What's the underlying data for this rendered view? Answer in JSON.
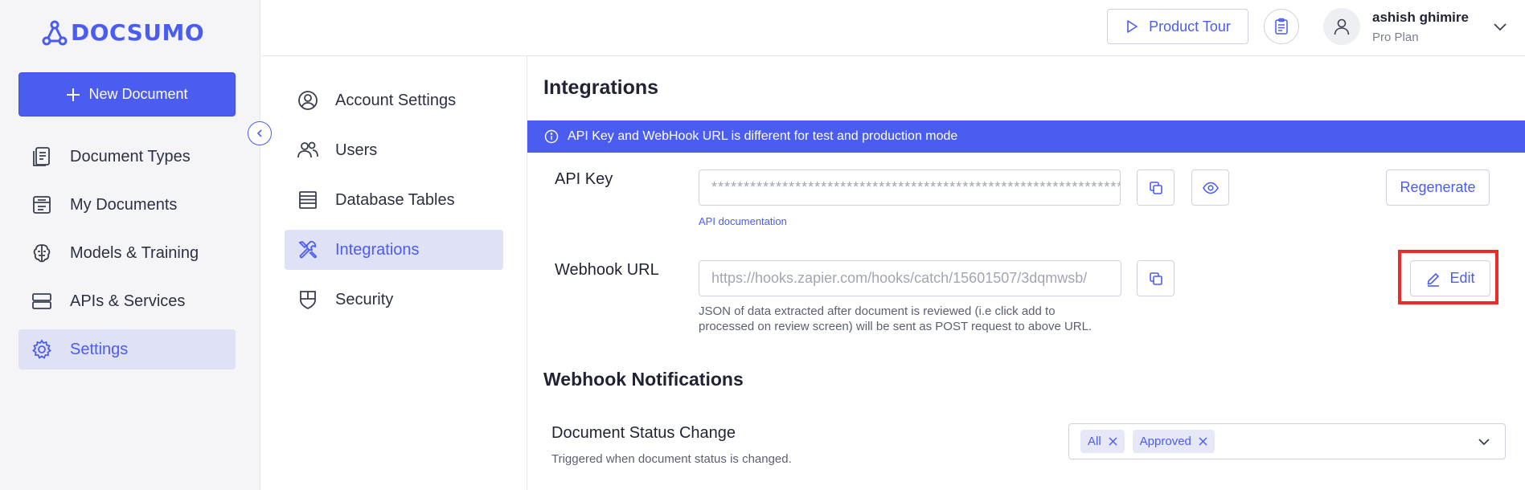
{
  "app": {
    "brand": "DOCSUMO"
  },
  "sidebar": {
    "new_document_label": "New Document",
    "items": [
      {
        "label": "Document Types",
        "icon": "document-types-icon"
      },
      {
        "label": "My Documents",
        "icon": "my-documents-icon"
      },
      {
        "label": "Models & Training",
        "icon": "brain-icon"
      },
      {
        "label": "APIs & Services",
        "icon": "server-icon"
      },
      {
        "label": "Settings",
        "icon": "gear-icon",
        "active": true
      }
    ]
  },
  "settings_nav": {
    "items": [
      {
        "label": "Account Settings",
        "icon": "user-circle-icon"
      },
      {
        "label": "Users",
        "icon": "users-icon"
      },
      {
        "label": "Database Tables",
        "icon": "table-icon"
      },
      {
        "label": "Integrations",
        "icon": "tools-icon",
        "active": true
      },
      {
        "label": "Security",
        "icon": "shield-icon"
      }
    ]
  },
  "header": {
    "product_tour_label": "Product Tour",
    "user": {
      "name": "ashish ghimire",
      "plan": "Pro Plan"
    }
  },
  "main": {
    "title": "Integrations",
    "banner_text": "API Key and WebHook URL is different for test and production mode",
    "api_key": {
      "label": "API Key",
      "value": "****************************************************************",
      "doc_link": "API documentation",
      "regenerate_label": "Regenerate"
    },
    "webhook": {
      "label": "Webhook URL",
      "value": "https://hooks.zapier.com/hooks/catch/15601507/3dqmwsb/",
      "help_line1": "JSON of data extracted after document is reviewed (i.e click add to",
      "help_line2": "processed on review screen) will be sent as POST request to above URL.",
      "edit_label": "Edit"
    },
    "notifications": {
      "title": "Webhook Notifications",
      "doc_status": {
        "title": "Document Status Change",
        "description": "Triggered when document status is changed.",
        "selected_tags": [
          "All",
          "Approved"
        ]
      }
    }
  },
  "colors": {
    "accent": "#4b5cf0",
    "highlight": "#ef2a26",
    "active_bg": "#dfe1f6"
  }
}
